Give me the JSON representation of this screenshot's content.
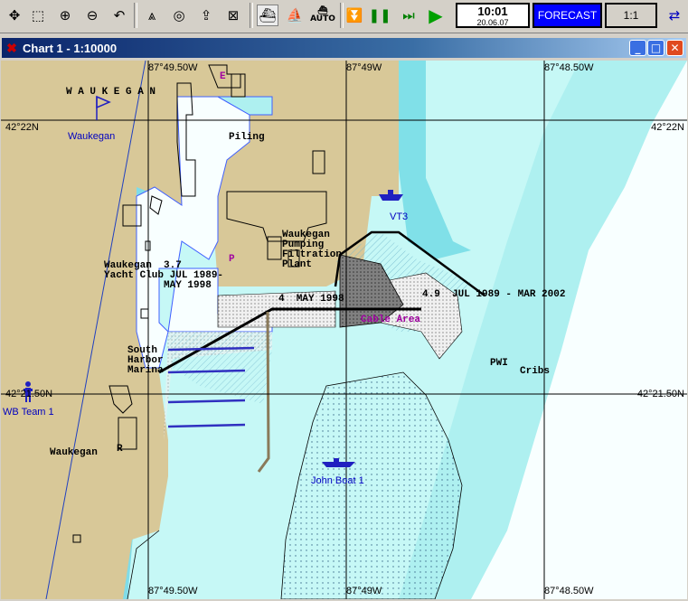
{
  "toolbar": {
    "time": "10:01",
    "date": "20.06.07",
    "forecast_label": "FORECAST",
    "scale_label": "1:1",
    "auto_label": "AUTO"
  },
  "window": {
    "title": "Chart 1 - 1:10000"
  },
  "chart": {
    "lon_labels": {
      "a": "87°49.50W",
      "b": "87°49W",
      "c": "87°48.50W"
    },
    "lat_labels": {
      "a": "42°22N",
      "b": "42°21.50N"
    },
    "labels": {
      "waukegan_city": "W A U K E G A N",
      "waukegan_marker": "Waukegan",
      "piling": "Piling",
      "pumping": "Waukegan\nPumping\nFiltration\nPlant",
      "yacht": "Waukegan  3.7\nYacht Club JUL 1989-\n          MAY 1998",
      "may": "4  MAY 1998",
      "jul_mar": "4.9  JUL 1989 - MAR 2002",
      "cable": "Cable Area",
      "south_harbor": "South\nHarbor\nMarina",
      "pwi": "PWI",
      "cribs": "Cribs",
      "waukegan_r": "Waukegan",
      "r_mark": "R",
      "p_mark": "P",
      "vt3": "VT3",
      "wb_team": "WB Team 1",
      "john_boat": "John Boat 1",
      "e_mark": "E"
    }
  }
}
